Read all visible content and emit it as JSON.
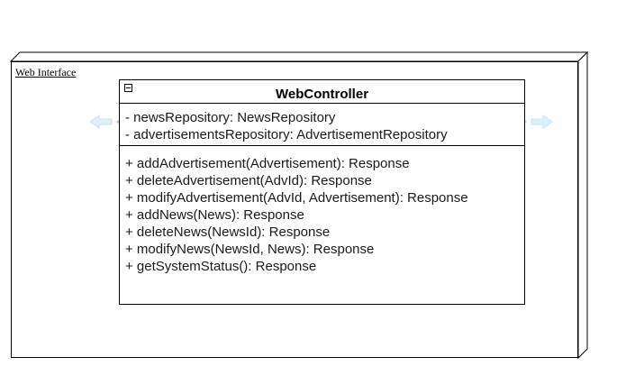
{
  "package": {
    "label": "Web Interface"
  },
  "class": {
    "name": "WebController",
    "attributes": [
      "- newsRepository: NewsRepository",
      "- advertisementsRepository: AdvertisementRepository"
    ],
    "operations": [
      "+ addAdvertisement(Advertisement): Response",
      "+ deleteAdvertisement(AdvId): Response",
      "+ modifyAdvertisement(AdvId, Advertisement): Response",
      "+ addNews(News): Response",
      "+ deleteNews(NewsId): Response",
      "+ modifyNews(NewsId, News): Response",
      "+ getSystemStatus(): Response"
    ]
  },
  "colors": {
    "hover_arrow": "#dbeefb",
    "line": "#000000"
  }
}
